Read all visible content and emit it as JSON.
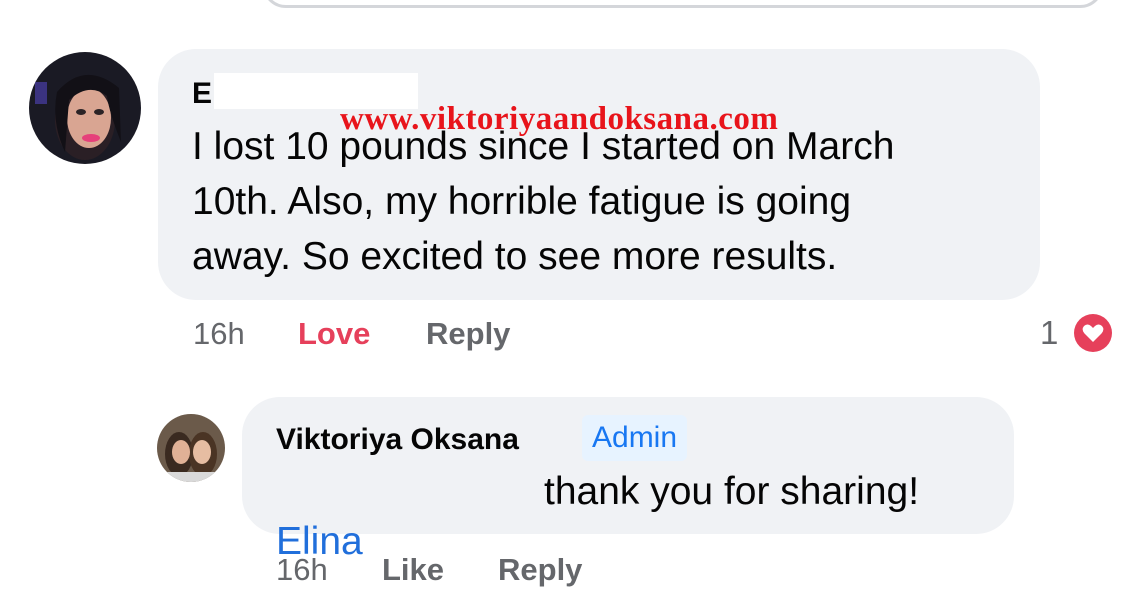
{
  "comment": {
    "author_initial": "E",
    "watermark": "www.viktoriyaandoksana.com",
    "text": "I lost 10 pounds since I started on March\n10th. Also, my horrible fatigue is going\naway. So excited to see more results.",
    "time": "16h",
    "love_label": "Love",
    "reply_label": "Reply",
    "reaction_count": "1",
    "reaction_icon": "heart-icon",
    "heart_color": "#e6405b"
  },
  "reply": {
    "author": "Viktoriya Oksana",
    "badge": "Admin",
    "mention": "Elina",
    "text": "thank you for sharing!",
    "time": "16h",
    "like_label": "Like",
    "reply_label": "Reply"
  },
  "colors": {
    "bubble": "#f0f2f5",
    "meta": "#65676b",
    "link": "#1877f2"
  }
}
